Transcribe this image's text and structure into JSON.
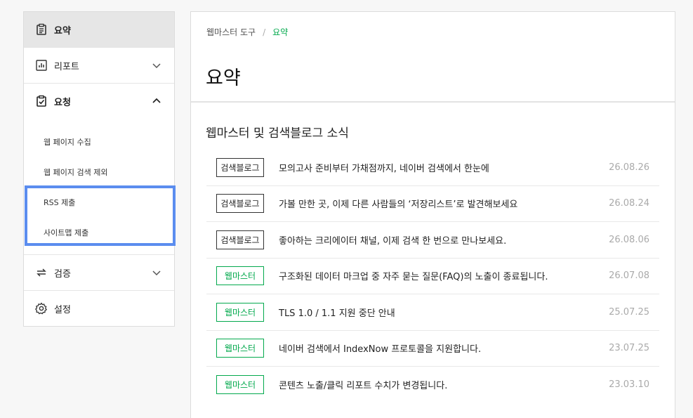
{
  "sidebar": {
    "items": [
      {
        "label": "요약",
        "icon": "clipboard-icon"
      },
      {
        "label": "리포트",
        "icon": "chart-icon"
      },
      {
        "label": "요청",
        "icon": "clipboard-check-icon"
      },
      {
        "label": "검증",
        "icon": "sync-icon"
      },
      {
        "label": "설정",
        "icon": "gear-icon"
      }
    ],
    "sub_items": [
      "웹 페이지 수집",
      "웹 페이지 검색 제외",
      "RSS 제출",
      "사이트맵 제출"
    ]
  },
  "breadcrumb": {
    "root": "웹마스터 도구",
    "separator": "/",
    "current": "요약"
  },
  "main": {
    "title": "요약",
    "section_title": "웹마스터 및 검색블로그 소식",
    "news": [
      {
        "tag": "검색블로그",
        "type": "blog",
        "title": "모의고사 준비부터 가채점까지, 네이버 검색에서 한눈에",
        "date": "26.08.26"
      },
      {
        "tag": "검색블로그",
        "type": "blog",
        "title": "가볼 만한 곳, 이제 다른 사람들의 ‘저장리스트’로 발견해보세요",
        "date": "26.08.24"
      },
      {
        "tag": "검색블로그",
        "type": "blog",
        "title": "좋아하는 크리에이터 채널, 이제 검색 한 번으로 만나보세요.",
        "date": "26.08.06"
      },
      {
        "tag": "웹마스터",
        "type": "wm",
        "title": "구조화된 데이터 마크업 중 자주 묻는 질문(FAQ)의 노출이 종료됩니다.",
        "date": "26.07.08"
      },
      {
        "tag": "웹마스터",
        "type": "wm",
        "title": "TLS 1.0 / 1.1 지원 중단 안내",
        "date": "25.07.25"
      },
      {
        "tag": "웹마스터",
        "type": "wm",
        "title": "네이버 검색에서 IndexNow 프로토콜을 지원합니다.",
        "date": "23.07.25"
      },
      {
        "tag": "웹마스터",
        "type": "wm",
        "title": "콘텐츠 노출/클릭 리포트 수치가 변경됩니다.",
        "date": "23.03.10"
      }
    ]
  },
  "colors": {
    "accent": "#03a94d",
    "highlight": "#5b8def",
    "active_bg": "#e6e6e6"
  }
}
